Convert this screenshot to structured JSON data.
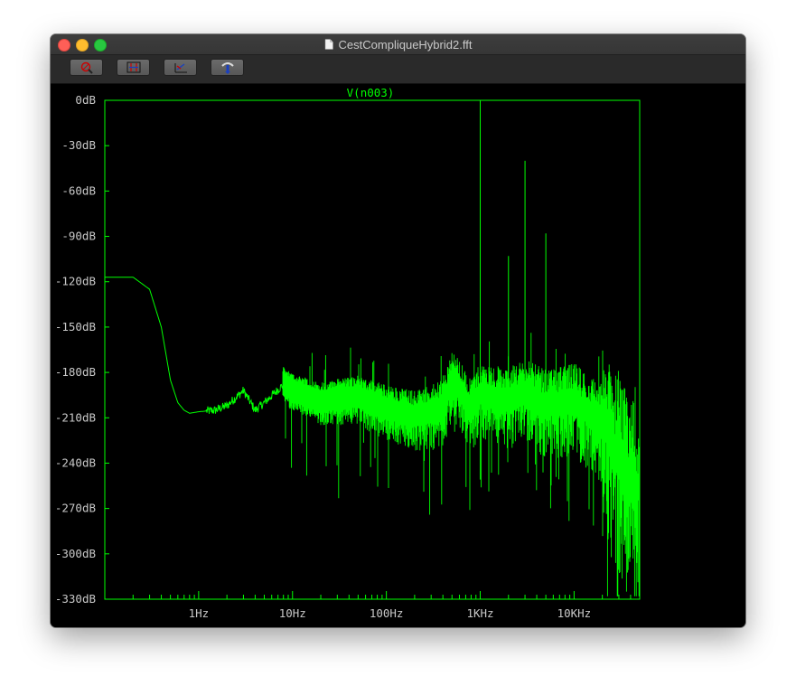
{
  "window": {
    "title": "CestCompliqueHybrid2.fft"
  },
  "toolbar": {
    "buttons": [
      {
        "name": "zoom-icon"
      },
      {
        "name": "autorange-icon"
      },
      {
        "name": "pan-icon"
      },
      {
        "name": "marker-icon"
      }
    ]
  },
  "colors": {
    "trace": "#00ff00",
    "axis": "#00ff00",
    "label": "#c8c8c8",
    "background": "#000000"
  },
  "chart_data": {
    "type": "line",
    "title": "V(n003)",
    "x_scale": "log",
    "xlim_hz": [
      0.1,
      50000
    ],
    "ylim_db": [
      -330,
      0
    ],
    "y_ticks": [
      "0dB",
      "-30dB",
      "-60dB",
      "-90dB",
      "-120dB",
      "-150dB",
      "-180dB",
      "-210dB",
      "-240dB",
      "-270dB",
      "-300dB",
      "-330dB"
    ],
    "x_ticks": [
      "1Hz",
      "10Hz",
      "100Hz",
      "1KHz",
      "10KHz"
    ],
    "series": [
      {
        "color": "#00ff00",
        "x": [
          0.1,
          0.2,
          0.3,
          0.4,
          0.5,
          0.6,
          0.7,
          0.8,
          1,
          1.5,
          2,
          3,
          4,
          5,
          8,
          10,
          20,
          50,
          100,
          200,
          400,
          500,
          800,
          1000,
          2000,
          3000,
          5000,
          10000,
          20000,
          50000
        ],
        "y": [
          -117,
          -117,
          -125,
          -150,
          -185,
          -200,
          -205,
          -207,
          -206,
          -205,
          -202,
          -192,
          -205,
          -200,
          -188,
          -193,
          -200,
          -197,
          -205,
          -210,
          -205,
          -185,
          -205,
          -195,
          -200,
          -195,
          -203,
          -200,
          -215,
          -260
        ]
      }
    ],
    "peaks": [
      {
        "x": 1000,
        "y": 0
      },
      {
        "x": 2000,
        "y": -103
      },
      {
        "x": 3000,
        "y": -40
      },
      {
        "x": 5000,
        "y": -88
      }
    ]
  }
}
